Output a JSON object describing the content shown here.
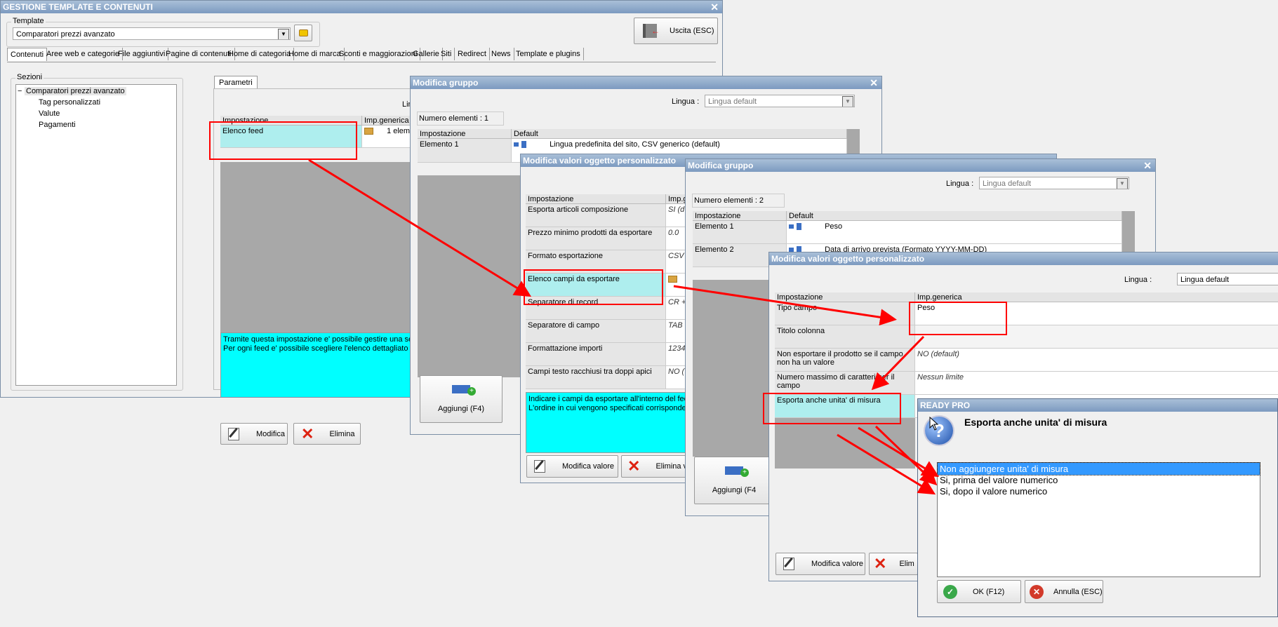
{
  "main": {
    "title": "GESTIONE TEMPLATE E CONTENUTI",
    "template_legend": "Template",
    "template_value": "Comparatori prezzi avanzato",
    "exit_label": "Uscita (ESC)",
    "tabs": [
      "Contenuti",
      "Aree web e categorie",
      "File aggiuntivi",
      "Pagine di contenuti",
      "Home di categoria",
      "Home di marca",
      "Sconti e maggiorazioni",
      "Gallerie",
      "Siti",
      "Redirect",
      "News",
      "Template e plugins"
    ],
    "sezioni_legend": "Sezioni",
    "tree": [
      "Comparatori prezzi avanzato",
      "Tag personalizzati",
      "Valute",
      "Pagamenti"
    ],
    "tree_toggle": "−",
    "params_tab": "Parametri",
    "lingua_partial": "Lin",
    "col_impostazione": "Impostazione",
    "col_impgenerica": "Imp.generica",
    "row_label": "Elenco feed",
    "row_value": "1 eleme",
    "desc_line1": "Tramite questa impostazione e' possibile gestire una seri",
    "desc_line2": "Per ogni feed e' possibile scegliere l'elenco dettagliato de",
    "modifica_label": "Modifica",
    "elimina_label": "Elimina"
  },
  "group1": {
    "title": "Modifica gruppo",
    "lingua_label": "Lingua :",
    "lingua_value": "Lingua default",
    "count": "Numero elementi : 1",
    "col_impostazione": "Impostazione",
    "col_default": "Default",
    "row_label": "Elemento 1",
    "row_value": "Lingua predefinita del sito, CSV generico (default)",
    "aggiungi_label": "Aggiungi (F4)"
  },
  "custom1": {
    "title": "Modifica valori oggetto personalizzato",
    "col_impostazione": "Impostazione",
    "col_imp": "Imp.g",
    "rows": [
      {
        "label": "Esporta articoli composizione",
        "value": "SI (d"
      },
      {
        "label": "Prezzo minimo prodotti da esportare",
        "value": "0.0"
      },
      {
        "label": "Formato esportazione",
        "value": "CSV"
      },
      {
        "label": "Elenco campi da esportare",
        "value": ""
      },
      {
        "label": "Separatore di record",
        "value": "CR +"
      },
      {
        "label": "Separatore di campo",
        "value": "TAB"
      },
      {
        "label": "Formattazione importi",
        "value": "1234"
      },
      {
        "label": "Campi testo racchiusi tra doppi apici",
        "value": "NO ("
      }
    ],
    "desc_line1": "Indicare i campi da esportare all'interno del fee",
    "desc_line2": "L'ordine in cui vengono specificati corrisponder",
    "modifica_label": "Modifica valore",
    "elimina_label": "Elimina va"
  },
  "group2": {
    "title": "Modifica gruppo",
    "lingua_label": "Lingua :",
    "lingua_value": "Lingua default",
    "count": "Numero elementi : 2",
    "col_impostazione": "Impostazione",
    "col_default": "Default",
    "rows": [
      {
        "label": "Elemento 1",
        "value": "Peso"
      },
      {
        "label": "Elemento 2",
        "value": "Data di arrivo prevista (Formato YYYY-MM-DD)"
      }
    ],
    "aggiungi_label": "Aggiungi (F4"
  },
  "custom2": {
    "title": "Modifica valori oggetto personalizzato",
    "lingua_label": "Lingua :",
    "lingua_value": "Lingua default",
    "col_impostazione": "Impostazione",
    "col_imp": "Imp.generica",
    "rows": [
      {
        "label": "Tipo campo",
        "value": "Peso"
      },
      {
        "label": "Titolo colonna",
        "value": ""
      },
      {
        "label": "Non esportare il prodotto se il campo non ha un valore",
        "value": "NO (default)"
      },
      {
        "label": "Numero massimo di caratteri per il campo",
        "value": "Nessun limite"
      },
      {
        "label": "Esporta anche unita' di misura",
        "value": ""
      }
    ],
    "modifica_label": "Modifica valore",
    "elimina_label": "Elim"
  },
  "ready": {
    "title": "READY PRO",
    "question": "Esporta anche unita' di misura",
    "options": [
      "Non aggiungere unita' di misura",
      "Si, prima del valore numerico",
      "Si, dopo il valore numerico"
    ],
    "ok_label": "OK (F12)",
    "cancel_label": "Annulla (ESC)"
  }
}
